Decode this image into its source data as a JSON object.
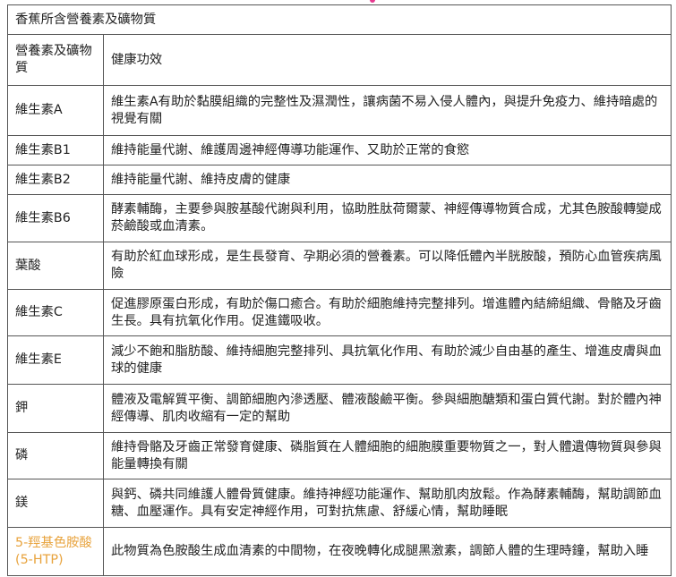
{
  "table": {
    "title": "香蕉所含營養素及礦物質",
    "header": {
      "nutrient": "營養素及礦物質",
      "benefit": "健康功效"
    },
    "rows": [
      {
        "nutrient": "維生素A",
        "benefit": "維生素A有助於黏膜組織的完整性及濕潤性，讓病菌不易入侵人體內，與提升免疫力、維持暗處的視覺有關"
      },
      {
        "nutrient": "維生素B1",
        "benefit": "維持能量代謝、維護周邊神經傳導功能運作、又助於正常的食慾"
      },
      {
        "nutrient": "維生素B2",
        "benefit": "維持能量代謝、維持皮膚的健康"
      },
      {
        "nutrient": "維生素B6",
        "benefit": "酵素輔酶，主要參與胺基酸代謝與利用，協助胜肽荷爾蒙、神經傳導物質合成，尤其色胺酸轉變成菸鹼酸或血清素。"
      },
      {
        "nutrient": "葉酸",
        "benefit": "有助於紅血球形成，是生長發育、孕期必須的營養素。可以降低體內半胱胺酸，預防心血管疾病風險"
      },
      {
        "nutrient": "維生素C",
        "benefit": "促進膠原蛋白形成，有助於傷口癒合。有助於細胞維持完整排列。增進體內結締組織、骨骼及牙齒生長。具有抗氧化作用。促進鐵吸收。"
      },
      {
        "nutrient": "維生素E",
        "benefit": "減少不飽和脂肪酸、維持細胞完整排列、具抗氧化作用、有助於減少自由基的產生、增進皮膚與血球的健康"
      },
      {
        "nutrient": "鉀",
        "benefit": "體液及電解質平衡、調節細胞內滲透壓、體液酸鹼平衡。參與細胞醣類和蛋白質代謝。對於體內神經傳導、肌肉收縮有一定的幫助"
      },
      {
        "nutrient": "磷",
        "benefit": "維持骨骼及牙齒正常發育健康、磷脂質在人體細胞的細胞膜重要物質之一，對人體遺傳物質與參與能量轉換有關"
      },
      {
        "nutrient": "鎂",
        "benefit": "與鈣、磷共同維護人體骨質健康。維持神經功能運作、幫助肌肉放鬆。作為酵素輔酶，幫助調節血糖、血壓運作。具有安定神經作用，可對抗焦慮、舒緩心情，幫助睡眠"
      },
      {
        "nutrient": "5-羥基色胺酸(5-HTP)",
        "benefit": "此物質為色胺酸生成血清素的中間物，在夜晚轉化成腿黑激素，調節人體的生理時鐘，幫助入睡"
      }
    ]
  },
  "colors": {
    "border": "#555555",
    "text": "#222222",
    "highlight": "#e8a33d",
    "accent": "#e6398f"
  }
}
